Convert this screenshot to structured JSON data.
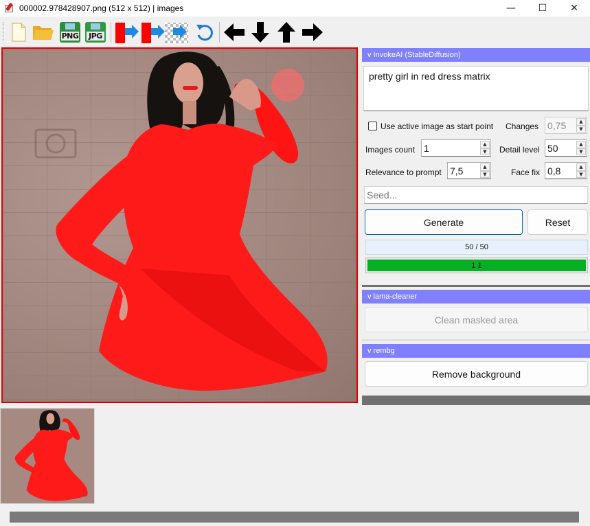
{
  "window": {
    "title": "000002.978428907.png (512 x 512) | images",
    "minimize_glyph": "—",
    "maximize_glyph": "☐",
    "close_glyph": "✕"
  },
  "toolbar": {
    "icons": [
      "new-file-icon",
      "open-folder-icon",
      "save-png-icon",
      "save-jpg-icon",
      "red-to-blue-arrow-icon",
      "red-to-transparent-arrow-icon",
      "undo-icon",
      "arrow-left-icon",
      "arrow-down-icon",
      "arrow-up-icon",
      "arrow-right-icon"
    ],
    "png_label": "PNG",
    "jpg_label": "JPG"
  },
  "invokeai": {
    "header": "v InvokeAI (StableDiffusion)",
    "prompt": "pretty girl in red dress matrix",
    "use_active_label": "Use active image as start point",
    "use_active_checked": false,
    "changes_label": "Changes",
    "changes_value": "0,75",
    "images_count_label": "Images count",
    "images_count_value": "1",
    "detail_level_label": "Detail level",
    "detail_level_value": "50",
    "relevance_label": "Relevance to prompt",
    "relevance_value": "7,5",
    "face_fix_label": "Face fix",
    "face_fix_value": "0,8",
    "seed_placeholder": "Seed...",
    "generate_label": "Generate",
    "reset_label": "Reset",
    "steps_text": "50 / 50",
    "progress_text": "1   1",
    "progress_fraction": 1.0
  },
  "lama": {
    "header": "v lama-cleaner",
    "clean_label": "Clean masked area"
  },
  "rembg": {
    "header": "v rembg",
    "remove_label": "Remove background"
  },
  "colors": {
    "section_header": "#8080ff",
    "canvas_border": "#e00000",
    "dress_red": "#ff1a1a",
    "progress_green": "#06b025",
    "primary_border": "#0067c0"
  }
}
